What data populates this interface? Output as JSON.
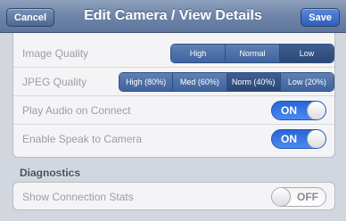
{
  "navbar": {
    "title": "Edit Camera / View Details",
    "cancel_label": "Cancel",
    "save_label": "Save"
  },
  "settings": {
    "image_quality": {
      "label": "Image Quality",
      "options": [
        "High",
        "Normal",
        "Low"
      ],
      "selected": "Low"
    },
    "jpeg_quality": {
      "label": "JPEG Quality",
      "options": [
        "High (80%)",
        "Med (60%)",
        "Norm (40%)",
        "Low (20%)"
      ],
      "selected": "Norm (40%)"
    },
    "play_audio": {
      "label": "Play Audio on Connect",
      "state": "ON"
    },
    "enable_speak": {
      "label": "Enable Speak to Camera",
      "state": "ON"
    }
  },
  "diagnostics": {
    "header": "Diagnostics",
    "show_connection_stats": {
      "label": "Show Connection Stats",
      "state": "OFF"
    }
  },
  "colors": {
    "navbar": "#6e84a8",
    "segmented": "#4a6ba0",
    "toggle_on": "#2f6fe0"
  }
}
